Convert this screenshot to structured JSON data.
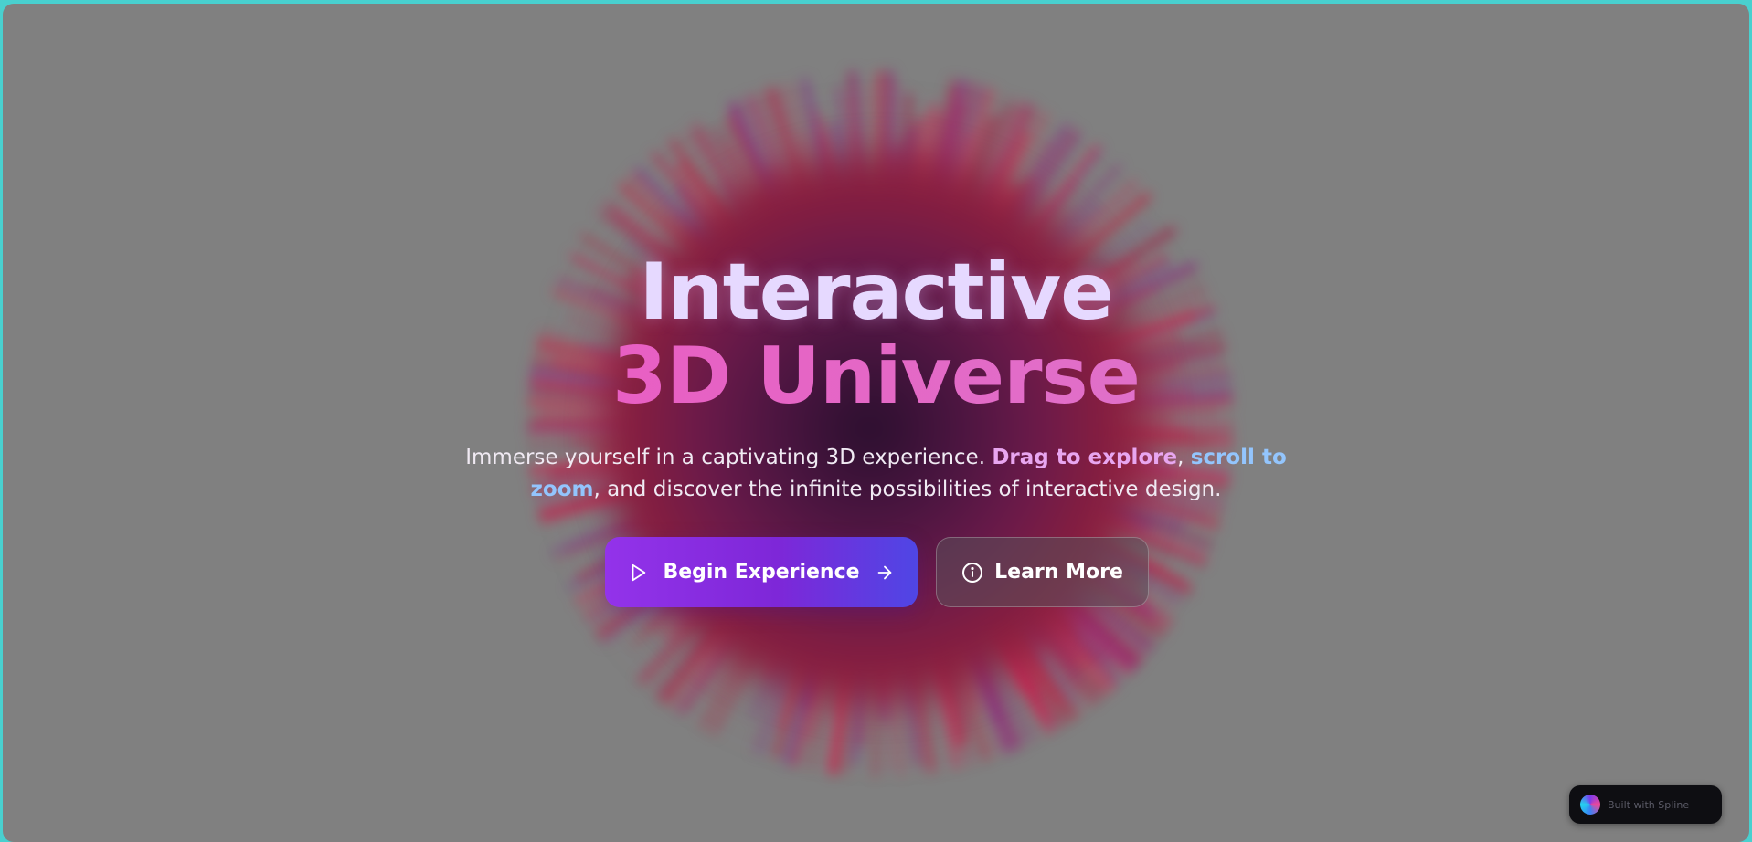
{
  "hero": {
    "title_line1": "Interactive",
    "title_line2": "3D Universe",
    "subtitle_prefix": "Immerse yourself in a captivating 3D experience. ",
    "subtitle_highlight1": "Drag to explore",
    "subtitle_sep": ", ",
    "subtitle_highlight2": "scroll to zoom",
    "subtitle_suffix": ", and discover the infinite possibilities of interactive design."
  },
  "buttons": {
    "primary_label": "Begin Experience",
    "primary_icon_left": "play-icon",
    "primary_icon_right": "arrow-right-icon",
    "secondary_label": "Learn More",
    "secondary_icon": "info-icon"
  },
  "badge": {
    "label": "Built with Spline",
    "icon": "spline-logo-icon"
  },
  "colors": {
    "background": "#808080",
    "frame_border": "#49d0cf",
    "primary_button_start": "#9333ea",
    "primary_button_end": "#4f46e5",
    "highlight_pink": "#e8a6f0",
    "highlight_blue": "#93c5fd"
  }
}
